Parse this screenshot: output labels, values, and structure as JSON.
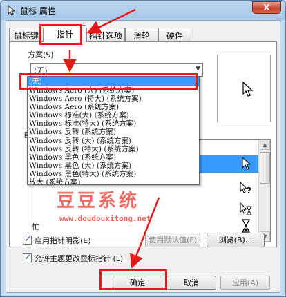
{
  "window": {
    "title": "鼠标 属性",
    "close_glyph": "X"
  },
  "tabs": [
    {
      "label": "鼠标键",
      "active": false
    },
    {
      "label": "指针",
      "active": true
    },
    {
      "label": "指针选项",
      "active": false
    },
    {
      "label": "滑轮",
      "active": false
    },
    {
      "label": "硬件",
      "active": false
    }
  ],
  "scheme": {
    "group_label": "方案(S)",
    "selected": "(无)",
    "options": [
      "(无)",
      "Windows Aero (大) (系统方案)",
      "Windows Aero (特大) (系统方案)",
      "Windows Aero (系统方案)",
      "Windows 标准(大) (系统方案)",
      "Windows 标准(特大) (系统方案)",
      "Windows 反转 (系统方案)",
      "Windows 反转 (大) (系统方案)",
      "Windows 反转 (特大) (系统方案)",
      "Windows 黑色 (系统方案)",
      "Windows 黑色 (大) (系统方案)",
      "Windows 黑色(特大) (系统方案)",
      "放大 (系统方案)"
    ]
  },
  "custom": {
    "label": "自",
    "rows": [
      {
        "label": "",
        "selected": true,
        "icon": "arrow-cursor-icon"
      },
      {
        "label": "",
        "selected": false,
        "icon": "help-cursor-icon"
      },
      {
        "label": "",
        "selected": false,
        "icon": "working-cursor-icon"
      },
      {
        "label": "忙",
        "selected": false,
        "icon": "hourglass-cursor-icon"
      },
      {
        "label": "",
        "selected": false,
        "icon": "precision-cursor-icon"
      }
    ]
  },
  "options": {
    "shadow_label": "启用指针阴影(E)",
    "theme_label": "允许主题更改鼠标指针 (L)"
  },
  "buttons": {
    "use_default": "使用默认值(F)",
    "browse": "浏览(B)...",
    "ok": "确定",
    "cancel": "取消",
    "apply": "应用(A)"
  },
  "watermark": {
    "title": "豆豆系统",
    "url": "www.doudouxitong.net"
  },
  "colors": {
    "highlight": "#3399ff",
    "annotation_red": "#e41a1a",
    "watermark": "#e8453a"
  }
}
